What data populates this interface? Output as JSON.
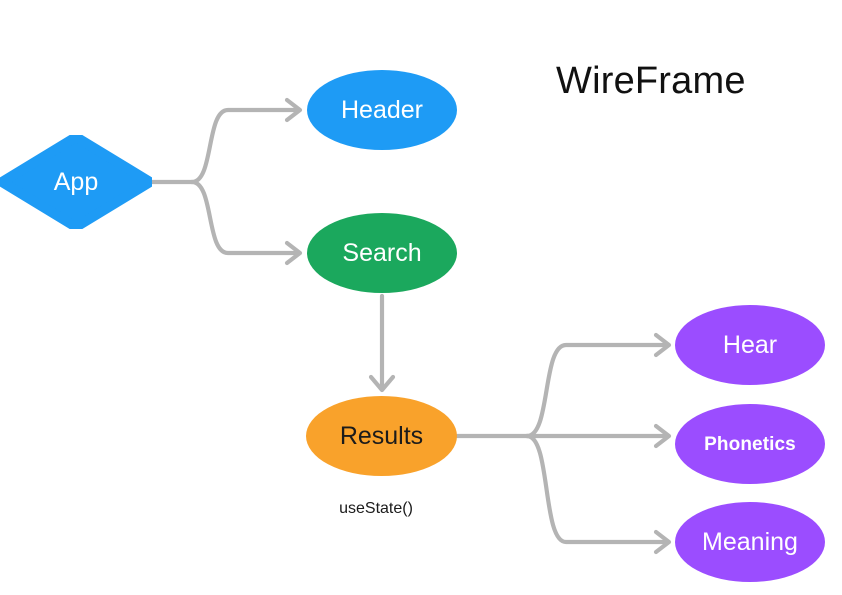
{
  "diagram": {
    "title": "WireFrame",
    "background_color": "#ffffff",
    "edge_color": "#b4b4b4",
    "nodes": [
      {
        "id": "app",
        "label": "App",
        "shape": "diamond",
        "fill": "#1e9bf5",
        "text_color": "#ffffff"
      },
      {
        "id": "header",
        "label": "Header",
        "shape": "ellipse",
        "fill": "#1e9bf5",
        "text_color": "#ffffff"
      },
      {
        "id": "search",
        "label": "Search",
        "shape": "ellipse",
        "fill": "#1ba85d",
        "text_color": "#ffffff"
      },
      {
        "id": "results",
        "label": "Results",
        "shape": "ellipse",
        "fill": "#f9a22b",
        "text_color": "#1b1b1b"
      },
      {
        "id": "hear",
        "label": "Hear",
        "shape": "ellipse",
        "fill": "#9b4dff",
        "text_color": "#ffffff"
      },
      {
        "id": "phonetics",
        "label": "Phonetics",
        "shape": "ellipse",
        "fill": "#9b4dff",
        "text_color": "#ffffff"
      },
      {
        "id": "meaning",
        "label": "Meaning",
        "shape": "ellipse",
        "fill": "#9b4dff",
        "text_color": "#ffffff"
      }
    ],
    "annotations": [
      {
        "id": "results-state",
        "text": "useState()",
        "attached_to": "results"
      }
    ],
    "edges": [
      {
        "from": "app",
        "to": "header",
        "style": "elbow-curved",
        "arrow": "chevron"
      },
      {
        "from": "app",
        "to": "search",
        "style": "elbow-curved",
        "arrow": "chevron"
      },
      {
        "from": "search",
        "to": "results",
        "style": "straight-vertical",
        "arrow": "chevron"
      },
      {
        "from": "results",
        "to": "hear",
        "style": "elbow-curved",
        "arrow": "chevron"
      },
      {
        "from": "results",
        "to": "phonetics",
        "style": "straight-horizontal",
        "arrow": "chevron"
      },
      {
        "from": "results",
        "to": "meaning",
        "style": "elbow-curved",
        "arrow": "chevron"
      }
    ]
  }
}
